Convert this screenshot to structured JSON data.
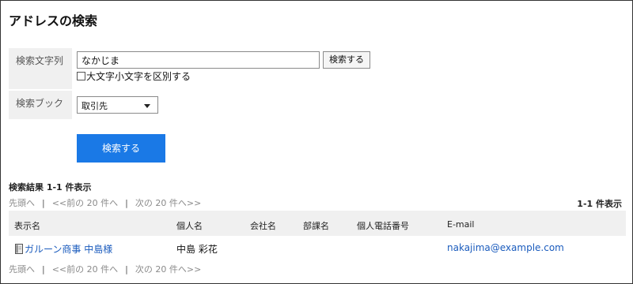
{
  "page": {
    "title": "アドレスの検索"
  },
  "form": {
    "text_label": "検索文字列",
    "text_value": "なかじま",
    "search_small_label": "検索する",
    "case_checkbox_label": "大文字小文字を区別する",
    "case_checked": false,
    "book_label": "検索ブック",
    "book_selected": "取引先",
    "search_button_label": "検索する"
  },
  "results": {
    "heading": "検索結果 1-1 件表示",
    "pager": {
      "first": "先頭へ",
      "prev": "<<前の 20 件へ",
      "next": "次の 20 件へ>>",
      "separator": "|"
    },
    "count_text": "1-1 件表示",
    "columns": [
      "表示名",
      "個人名",
      "会社名",
      "部課名",
      "個人電話番号",
      "E-mail"
    ],
    "rows": [
      {
        "display_name": "ガルーン商事 中島様",
        "person_name": "中島 彩花",
        "company": "",
        "department": "",
        "phone": "",
        "email": "nakajima@example.com",
        "icon": "address-book-icon"
      }
    ]
  },
  "colors": {
    "primary": "#1a79e6",
    "link": "#1a5bbd",
    "muted": "#8a8a8a",
    "label_bg": "#f0f0f0"
  }
}
